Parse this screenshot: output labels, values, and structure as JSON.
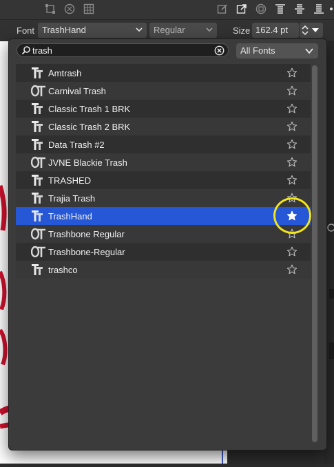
{
  "toolbar": {
    "icons": [
      "transform-icon",
      "compass-icon",
      "grid-icon",
      "edit-box-icon",
      "export-icon",
      "record-icon",
      "align-top-icon",
      "align-middle-icon",
      "align-bottom-icon",
      "more-icon"
    ]
  },
  "context_bar": {
    "font_label": "Font",
    "font_value": "TrashHand",
    "style_value": "Regular",
    "size_label": "Size",
    "size_value": "162.4 pt"
  },
  "popover": {
    "search_value": "trash",
    "filter_value": "All Fonts",
    "fonts": [
      {
        "name": "Amtrash",
        "icon": "truetype-icon",
        "favorite": false
      },
      {
        "name": "Carnival Trash",
        "icon": "opentype-icon",
        "favorite": false
      },
      {
        "name": "Classic Trash 1 BRK",
        "icon": "truetype-icon",
        "favorite": false
      },
      {
        "name": "Classic Trash 2 BRK",
        "icon": "truetype-icon",
        "favorite": false
      },
      {
        "name": "Data Trash #2",
        "icon": "truetype-icon",
        "favorite": false
      },
      {
        "name": "JVNE Blackie Trash",
        "icon": "opentype-icon",
        "favorite": false
      },
      {
        "name": "TRASHED",
        "icon": "truetype-icon",
        "favorite": false
      },
      {
        "name": "Trajia Trash",
        "icon": "truetype-icon",
        "favorite": false
      },
      {
        "name": "TrashHand",
        "icon": "truetype-icon",
        "favorite": true,
        "selected": true
      },
      {
        "name": "Trashbone Regular",
        "icon": "opentype-icon",
        "favorite": false
      },
      {
        "name": "Trashbone-Regular",
        "icon": "opentype-icon",
        "favorite": false
      },
      {
        "name": "trashco",
        "icon": "truetype-icon",
        "favorite": false
      }
    ]
  },
  "colors": {
    "selection": "#2557d6",
    "highlight_ring": "#f2e51a",
    "canvas_text": "#d0122f"
  }
}
